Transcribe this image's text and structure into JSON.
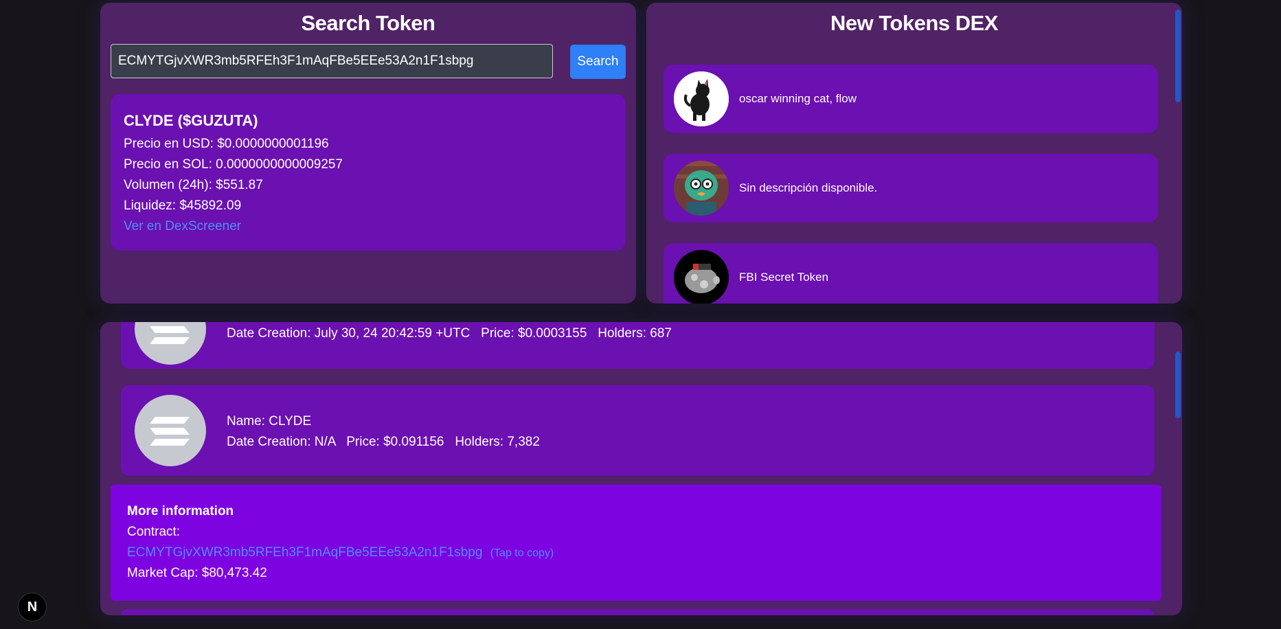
{
  "search": {
    "title": "Search Token",
    "input_value": "ECMYTGjvXWR3mb5RFEh3F1mAqFBe5EEe53A2n1F1sbpg",
    "button_label": "Search",
    "result": {
      "title": "CLYDE ($GUZUTA)",
      "price_usd": "Precio en USD: $0.0000000001196",
      "price_sol": "Precio en SOL: 0.0000000000009257",
      "volume": "Volumen (24h): $551.87",
      "liquidity": "Liquidez: $45892.09",
      "link": "Ver en DexScreener"
    }
  },
  "new_tokens": {
    "title": "New Tokens DEX",
    "items": [
      {
        "text": "oscar winning cat, flow",
        "icon": "cat-avatar-icon"
      },
      {
        "text": "Sin descripción disponible.",
        "icon": "frog-avatar-icon"
      },
      {
        "text": "FBI Secret Token",
        "icon": "piggy-bank-avatar-icon"
      }
    ]
  },
  "token_list": {
    "items": [
      {
        "name": "",
        "details": "Date Creation: July 30, 24 20:42:59 +UTC   Price: $0.0003155   Holders: 687"
      },
      {
        "name": "Name: CLYDE",
        "details": "Date Creation: N/A   Price: $0.091156   Holders: 7,382"
      }
    ],
    "more_info": {
      "heading": "More information",
      "contract_label": "Contract:",
      "contract": "ECMYTGjvXWR3mb5RFEh3F1mAqFBe5EEe53A2n1F1sbpg",
      "tap_to_copy": "(Tap to copy)",
      "market_cap": "Market Cap: $80,473.42"
    }
  },
  "badge": {
    "letter": "N"
  },
  "colors": {
    "background": "#17151a",
    "panel": "#502266",
    "card": "#6b10b1",
    "highlight": "#7e03e1",
    "accent": "#2f7ff6",
    "link": "#4e8ff5"
  }
}
